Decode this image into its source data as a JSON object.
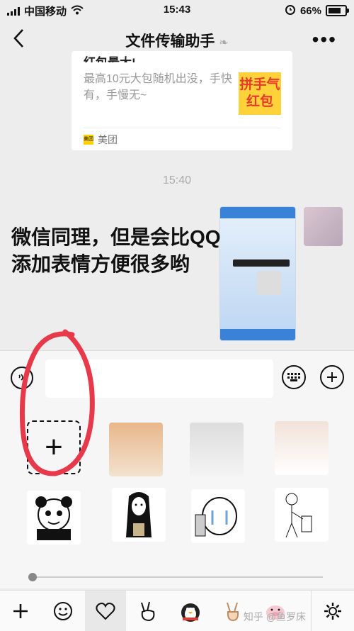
{
  "status_bar": {
    "carrier": "中国移动",
    "time": "15:43",
    "battery": "66%"
  },
  "nav": {
    "back_icon": "chevron-left-icon",
    "title": "文件传输助手",
    "more_icon": "more-dots-icon"
  },
  "chat": {
    "card": {
      "title_partial": "红包最大!",
      "description": "最高10元大包随机出没，手快有，手慢无~",
      "thumb_text": "拼手气红包",
      "source": "美团",
      "source_logo_text": "美团"
    },
    "timestamp": "15:40",
    "overlay_caption": "微信同理，但是会比QQ添加表情方便很多哟"
  },
  "input_bar": {
    "voice_icon": "voice-icon",
    "keyboard_icon": "keyboard-icon",
    "plus_icon": "plus-icon",
    "input_value": ""
  },
  "sticker_panel": {
    "add_label": "+",
    "stickers": [
      "cat-blush",
      "white-cat-sitting",
      "cat-with-jar",
      "panda-meme",
      "no-face-bucket",
      "bear-crying",
      "stick-figure"
    ]
  },
  "tab_bar": {
    "tabs": [
      "add-icon",
      "emoji-icon",
      "heart-icon",
      "peace-hand-icon",
      "penguin-icon",
      "v-hand-icon",
      "pig-icon"
    ],
    "watermark": "知乎 @鱼罗床"
  }
}
